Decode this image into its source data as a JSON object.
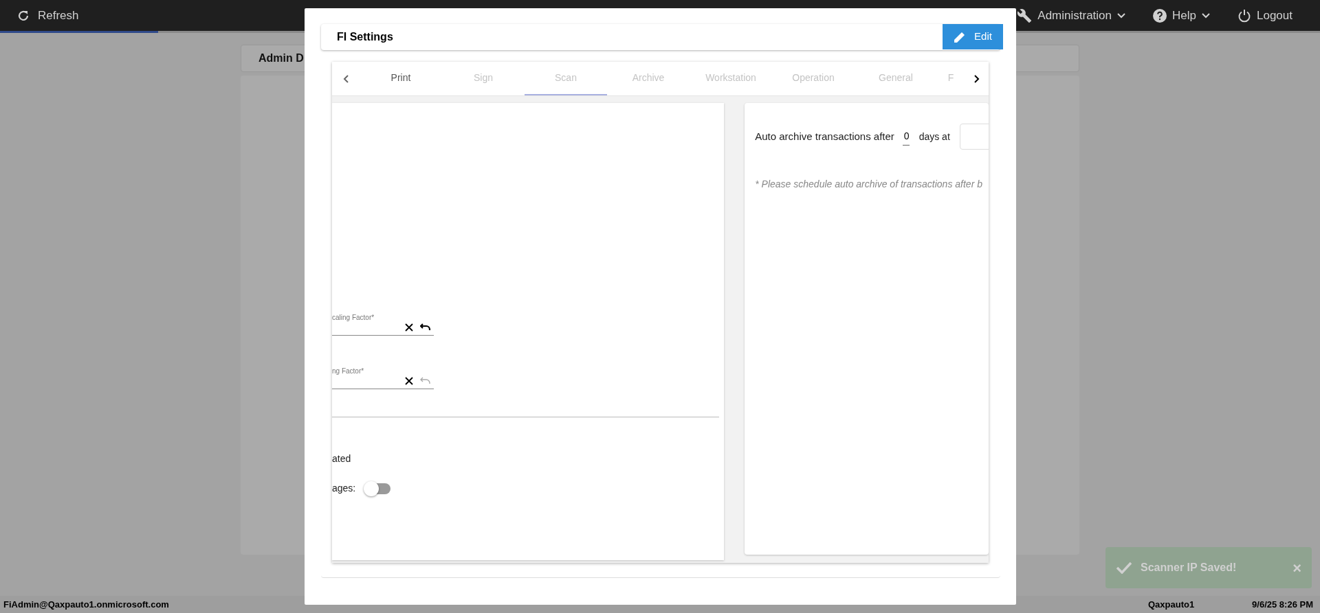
{
  "top_bar": {
    "refresh": "Refresh",
    "progress": {
      "level": 0.12
    },
    "menus": [
      {
        "label": "Administration",
        "kind": "dropdown"
      },
      {
        "label": "Help",
        "kind": "dropdown"
      },
      {
        "label": "Logout",
        "kind": "action"
      }
    ]
  },
  "background": {
    "card_title": "Admin D"
  },
  "dialog": {
    "title": "FI Settings",
    "edit_button": "Edit",
    "tabs": [
      {
        "label": "Print",
        "selected": false,
        "disabled": false
      },
      {
        "label": "Sign",
        "selected": false,
        "disabled": true
      },
      {
        "label": "Scan",
        "selected": true,
        "disabled": true
      },
      {
        "label": "Archive",
        "selected": false,
        "disabled": true
      },
      {
        "label": "Workstation",
        "selected": false,
        "disabled": true
      },
      {
        "label": "Operation",
        "selected": false,
        "disabled": true
      },
      {
        "label": "General",
        "selected": false,
        "disabled": true
      },
      {
        "label": "F",
        "selected": false,
        "disabled": true
      }
    ],
    "left_panel": {
      "fields": [
        {
          "label": "caling Factor*",
          "undo_enabled": true
        },
        {
          "label": "ng Factor*",
          "undo_enabled": false
        }
      ],
      "text": "ated",
      "toggle": {
        "label": "ages:",
        "on": false
      }
    },
    "right_panel": {
      "auto_archive_label": "Auto archive transactions after",
      "days_value": "0",
      "days_label": "days at",
      "note": "* Please schedule auto archive of transactions after b"
    }
  },
  "toast": {
    "message": "Scanner IP Saved!",
    "close": "×"
  },
  "status_bar": [
    {
      "text": "FiAdmin@Qaxpauto1.onmicrosoft.com"
    },
    {
      "text": "Qaxpauto1"
    },
    {
      "text": "9/6/25 8:26 PM"
    }
  ]
}
